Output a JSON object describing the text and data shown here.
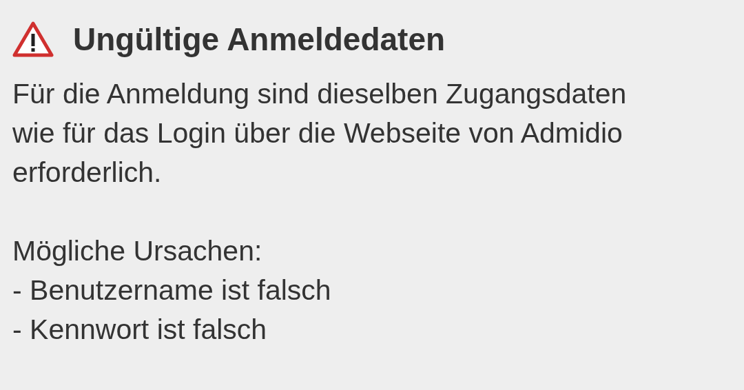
{
  "dialog": {
    "title": "Ungültige Anmeldedaten",
    "message_lines": [
      "Für die Anmeldung sind dieselben Zugangsdaten",
      "wie für das Login über die Webseite von Admidio",
      "erforderlich."
    ],
    "causes_heading": "Mögliche Ursachen:",
    "causes": [
      "- Benutzername ist falsch",
      "- Kennwort ist falsch"
    ]
  }
}
